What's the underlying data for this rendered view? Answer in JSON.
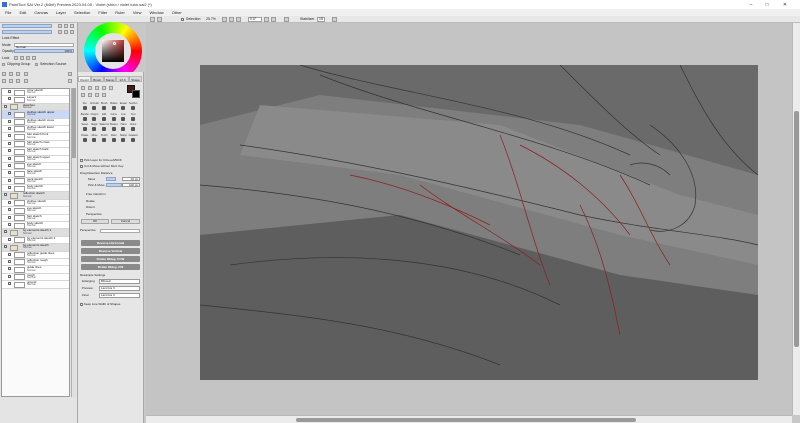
{
  "window": {
    "title": "PaintTool SAI Ver.2 (64bit) Preview.2023.04.05 - Violet (shiro / violet tuhn.sai2 (*)",
    "minimize_glyph": "–",
    "maximize_glyph": "□",
    "close_glyph": "✕"
  },
  "menu": [
    "File",
    "Edit",
    "Canvas",
    "Layer",
    "Selection",
    "Filter",
    "Ruler",
    "View",
    "Window",
    "Other"
  ],
  "toolbar": {
    "selection_label": "Selection",
    "zoom_value": "25.7%",
    "angle_value": "0.0°",
    "stabilizer_label": "Stabilizer",
    "stabilizer_value": "15"
  },
  "left_panel": {
    "lock_label": "Lock Effect",
    "blend_label": "Mode",
    "blend_value": "Normal",
    "opacity_label": "Opacity",
    "opacity_value": "100%",
    "lock_row_label": "Lock",
    "clipping_label": "Clipping Group",
    "selection_source_label": "Selection Source"
  },
  "layers": [
    {
      "name": "color sketch",
      "mode": "Normal",
      "type": "layer"
    },
    {
      "name": "Layer1",
      "mode": "Normal",
      "type": "layer"
    },
    {
      "name": "sketches",
      "mode": "Normal",
      "type": "folder"
    },
    {
      "name": "clothes sketch upper",
      "mode": "Normal",
      "type": "layer",
      "selected": true
    },
    {
      "name": "clothes sketch cross",
      "mode": "Normal",
      "type": "layer"
    },
    {
      "name": "clothes sketch lower",
      "mode": "Normal",
      "type": "layer"
    },
    {
      "name": "hair sketch front",
      "mode": "Normal",
      "type": "layer"
    },
    {
      "name": "hair sketch cross",
      "mode": "Normal",
      "type": "layer"
    },
    {
      "name": "hair sketch back",
      "mode": "Normal",
      "type": "layer"
    },
    {
      "name": "hair sketch upper",
      "mode": "Normal",
      "type": "layer"
    },
    {
      "name": "eye sketch",
      "mode": "Normal",
      "type": "layer"
    },
    {
      "name": "face sketch",
      "mode": "Normal",
      "type": "layer"
    },
    {
      "name": "neck sketch",
      "mode": "Normal",
      "type": "layer"
    },
    {
      "name": "body sketch",
      "mode": "Normal",
      "type": "layer"
    },
    {
      "name": "reflection sketch",
      "mode": "Normal",
      "type": "folder"
    },
    {
      "name": "clothes sketch",
      "mode": "Normal",
      "type": "layer"
    },
    {
      "name": "eye sketch",
      "mode": "Normal",
      "type": "layer"
    },
    {
      "name": "hair sketch",
      "mode": "Normal",
      "type": "layer"
    },
    {
      "name": "body sketch",
      "mode": "Normal",
      "type": "layer"
    },
    {
      "name": "bg elements sketch 2",
      "mode": "Normal",
      "type": "folder"
    },
    {
      "name": "bg elements sketch 2",
      "mode": "Normal",
      "type": "layer"
    },
    {
      "name": "bg elements sketch",
      "mode": "Normal",
      "type": "folder"
    },
    {
      "name": "reflection guide lines",
      "mode": "Normal",
      "type": "layer"
    },
    {
      "name": "reflection rough",
      "mode": "Normal",
      "type": "layer"
    },
    {
      "name": "guide lines",
      "mode": "Normal",
      "type": "layer"
    },
    {
      "name": "rough",
      "mode": "Normal",
      "type": "layer"
    },
    {
      "name": "ground",
      "mode": "Normal",
      "type": "layer"
    }
  ],
  "tool_tabs": [
    "Pencil",
    "Brush",
    "Stamp",
    "Inf.C",
    "Shape"
  ],
  "tools": [
    "Pen",
    "Airbrush",
    "Brush",
    "Marker",
    "Eraser",
    "Sel.Pen",
    "Blender",
    "Crayon",
    "Edit",
    "Curve",
    "Line",
    "Text",
    "Select",
    "Magic",
    "Watercol",
    "Bucket",
    "Hand",
    "Zoom",
    "Rotate",
    "Move",
    "Pencil",
    "Ruler",
    "Stamp",
    "Gradient"
  ],
  "tool_options": {
    "pick_layer": "Pick Layer for Ctrl+Left/Shift",
    "cut_move": "Cut & Move without Mod. Key",
    "drag_detection_label": "Drag Detection Distance",
    "move_label": "Move",
    "move_value": "10 px",
    "pick_move_label": "Pick & Move",
    "pick_move_value": "100 px",
    "free_transform": "Free transform",
    "rotate": "Rotate",
    "distort": "Distort",
    "perspective": "Perspective",
    "ok": "OK",
    "cancel": "Cancel",
    "perspective_label": "Perspective",
    "reverse_h": "Reverse Horizontal",
    "reverse_v": "Reverse Vertical",
    "rotate_ccw": "Rotate 90deg. CCW",
    "rotate_cw": "Rotate 90deg. CW",
    "resample_label": "Resample Settings",
    "enlarging_label": "Enlarging",
    "enlarging_value": "Bilinear",
    "preview_label": "Preview",
    "preview_value": "Lanczos 3",
    "final_label": "Final",
    "final_value": "Lanczos 3",
    "keep_line": "Keep Line Width of Shapes"
  }
}
